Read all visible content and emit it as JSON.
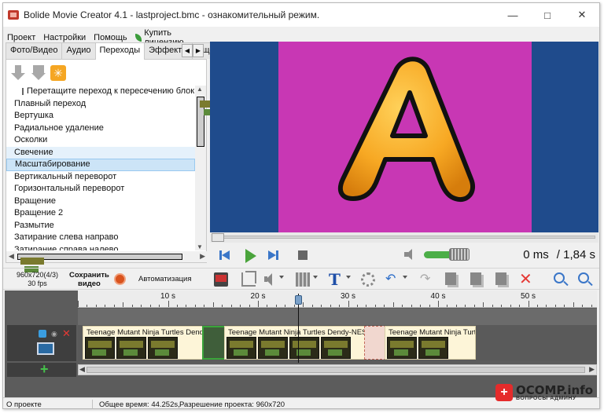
{
  "window": {
    "title": "Bolide Movie Creator 4.1 - lastproject.bmc  - ознакомительный режим."
  },
  "menu": {
    "items": [
      "Проект",
      "Настройки",
      "Помощь"
    ],
    "buy": "Купить лицензию"
  },
  "tabs": [
    "Фото/Видео",
    "Аудио",
    "Переходы",
    "Эффекты",
    "Еще"
  ],
  "transitions": {
    "drag_hint": "Перетащите переход к пересечению блок...",
    "items": [
      "Плавный переход",
      "Вертушка",
      "Радиальное удаление",
      "Осколки",
      "Свечение",
      "Масштабирование",
      "Вертикальный переворот",
      "Горизонтальный переворот",
      "Вращение",
      "Вращение 2",
      "Размытие",
      "Затирание слева направо",
      "Затирание справа налево"
    ],
    "hover_index": 4,
    "selected_index": 5
  },
  "preview": {
    "letter": "A",
    "frame_color": "#c837b4",
    "bg_color": "#1f4b8c",
    "letter_color": "#f7a823"
  },
  "player": {
    "current_time": "0 ms",
    "total_time": "/ 1,84 s",
    "seek_fraction": 0,
    "volume_fraction": 1.0
  },
  "toolbar": {
    "resolution": "960x720(4/3)",
    "fps": "30 fps",
    "save_video_line1": "Сохранить",
    "save_video_line2": "видео",
    "automation": "Автоматизация"
  },
  "timeline": {
    "ruler_labels": [
      "10 s",
      "20 s",
      "30 s",
      "40 s",
      "50 s"
    ],
    "clips": [
      {
        "title": "Teenage Mutant Ninja Turtles Dendy-..."
      },
      {
        "title": "Teenage Mutant Ninja Turtles Dendy-NES..."
      },
      {
        "title": "Teenage Mutant Ninja Turtl..."
      }
    ]
  },
  "status": {
    "about": "О проекте",
    "total_time": "Общее время: 44.252s,",
    "resolution": "Разрешение проекта:   960x720"
  },
  "watermark": {
    "brand": "OCOMP.info",
    "tagline": "ВОПРОСЫ АДМИНУ"
  }
}
